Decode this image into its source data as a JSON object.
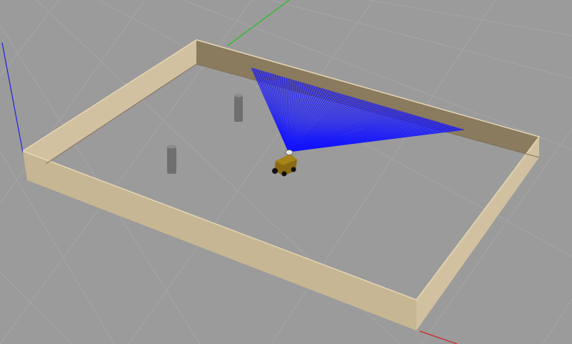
{
  "app": {
    "view": "3d-simulation-viewport"
  },
  "colors": {
    "ground": "#9b9b9b",
    "grid_line": "#a6a6a6",
    "wall_top": "#e6d6b4",
    "wall_face_light": "#d2c1a0",
    "wall_face_mid": "#c7b693",
    "wall_face_dark": "#8a7a5e",
    "wall_shadow": "#7f7058",
    "laser_scan": "#1414ff",
    "robot_body": "#8a6a12",
    "robot_wheel": "#111111",
    "robot_sensor": "#e8e8e8",
    "cylinder": "#6f6f6f",
    "axis_x": "#d02020",
    "axis_y": "#20c020",
    "axis_z": "#2020e0"
  },
  "scene": {
    "objects": [
      {
        "name": "arena-wall",
        "type": "wall-enclosure"
      },
      {
        "name": "cylinder-obstacle-1",
        "type": "cylinder"
      },
      {
        "name": "cylinder-obstacle-2",
        "type": "cylinder"
      },
      {
        "name": "mobile-robot",
        "type": "robot"
      },
      {
        "name": "laser-scan",
        "type": "laser-rays"
      }
    ]
  }
}
